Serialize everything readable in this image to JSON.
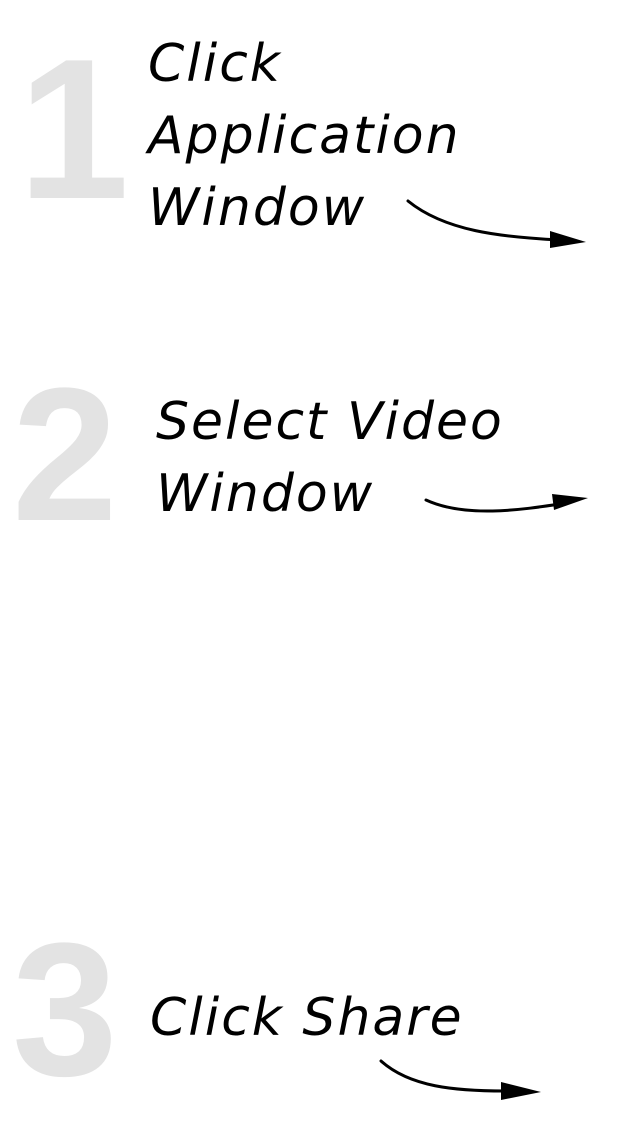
{
  "steps": [
    {
      "number": "1",
      "lines": [
        "Click",
        "Application",
        "Window"
      ]
    },
    {
      "number": "2",
      "lines": [
        "Select Video",
        "Window"
      ]
    },
    {
      "number": "3",
      "lines": [
        "Click Share"
      ]
    }
  ],
  "colors": {
    "step_number": "#e3e3e3",
    "text": "#000000",
    "background": "#ffffff"
  }
}
